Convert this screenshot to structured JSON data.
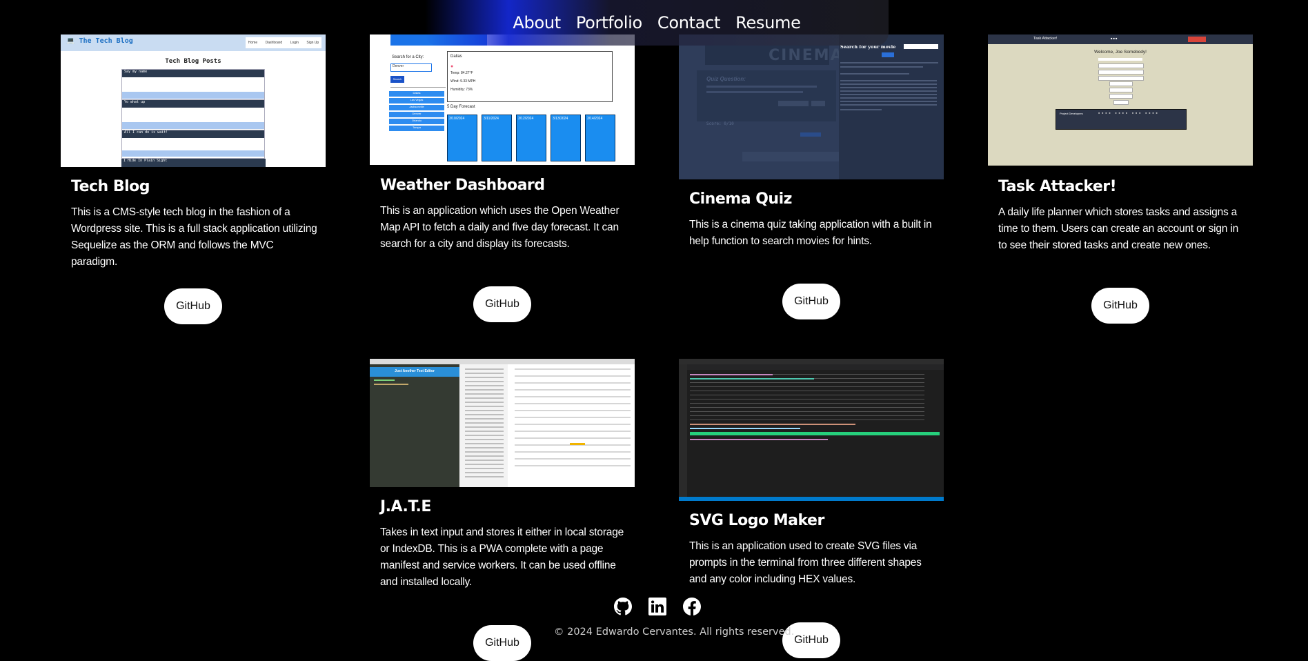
{
  "nav": {
    "items": [
      "About",
      "Portfolio",
      "Contact",
      "Resume"
    ]
  },
  "projects": [
    {
      "title": "Tech Blog",
      "description": "This is a CMS-style tech blog in the fashion of a Wordpress site. This is a full stack application utilizing Sequelize as the ORM and follows the MVC paradigm.",
      "button": "GitHub",
      "screenshot": {
        "brand": "💻 The Tech Blog",
        "nav": [
          "Home",
          "Dashboard",
          "Login",
          "Sign Up"
        ],
        "heading": "Tech Blog Posts",
        "posts": [
          "Say my name",
          "Yo what up",
          "All I can do is wait!",
          "I Hide In Plain Sight"
        ]
      }
    },
    {
      "title": "Weather Dashboard",
      "description": "This is an application which uses the Open Weather Map API to fetch a daily and five day forecast. It can search for a city and display its forecasts.",
      "button": "GitHub",
      "screenshot": {
        "search_label": "Search for a City:",
        "search_value": "Denver",
        "search_button": "Search",
        "city": "Dallas",
        "temp": "Temp: 84.27°F",
        "wind": "Wind: 9.33 MPH",
        "humidity": "Humidity: 73%",
        "forecast_title": "5 Day Forecast",
        "forecast_days": [
          "3/10/2024",
          "3/11/2024",
          "3/12/2024",
          "3/13/2024",
          "3/14/2024"
        ],
        "history": [
          "Dallas",
          "Las Vegas",
          "Jacksonville",
          "Denver",
          "Orlando",
          "Tampa"
        ]
      }
    },
    {
      "title": "Cinema Quiz",
      "description": "This is a cinema quiz taking application with a built in help function to search movies for hints.",
      "button": "GitHub",
      "screenshot": {
        "logo": "CINEMA",
        "question_title": "Quiz Question:",
        "search_title": "Search for your movie",
        "score": "Score: 0/10"
      }
    },
    {
      "title": "Task Attacker!",
      "description": "A daily life planner which stores tasks and assigns a time to them. Users can create an account or sign in to see their stored tasks and create new ones.",
      "button": "GitHub",
      "screenshot": {
        "brand": "Task Attacker!",
        "welcome": "Welcome, Joe Somebody!",
        "section": "Project Developers"
      }
    },
    {
      "title": "J.A.T.E",
      "description": "Takes in text input and stores it either in local storage or IndexDB. This is a PWA complete with a page manifest and service workers. It can be used offline and installed locally.",
      "button": "GitHub",
      "screenshot": {
        "header": "Just Another Text Editor"
      }
    },
    {
      "title": "SVG Logo Maker",
      "description": "This is an application used to create SVG files via prompts in the terminal from three different shapes and any color including HEX values.",
      "button": "GitHub",
      "screenshot": {}
    }
  ],
  "footer": {
    "social_icons": [
      "github-icon",
      "linkedin-icon",
      "facebook-icon"
    ],
    "copyright": "© 2024 Edwardo Cervantes. All rights reserved."
  }
}
